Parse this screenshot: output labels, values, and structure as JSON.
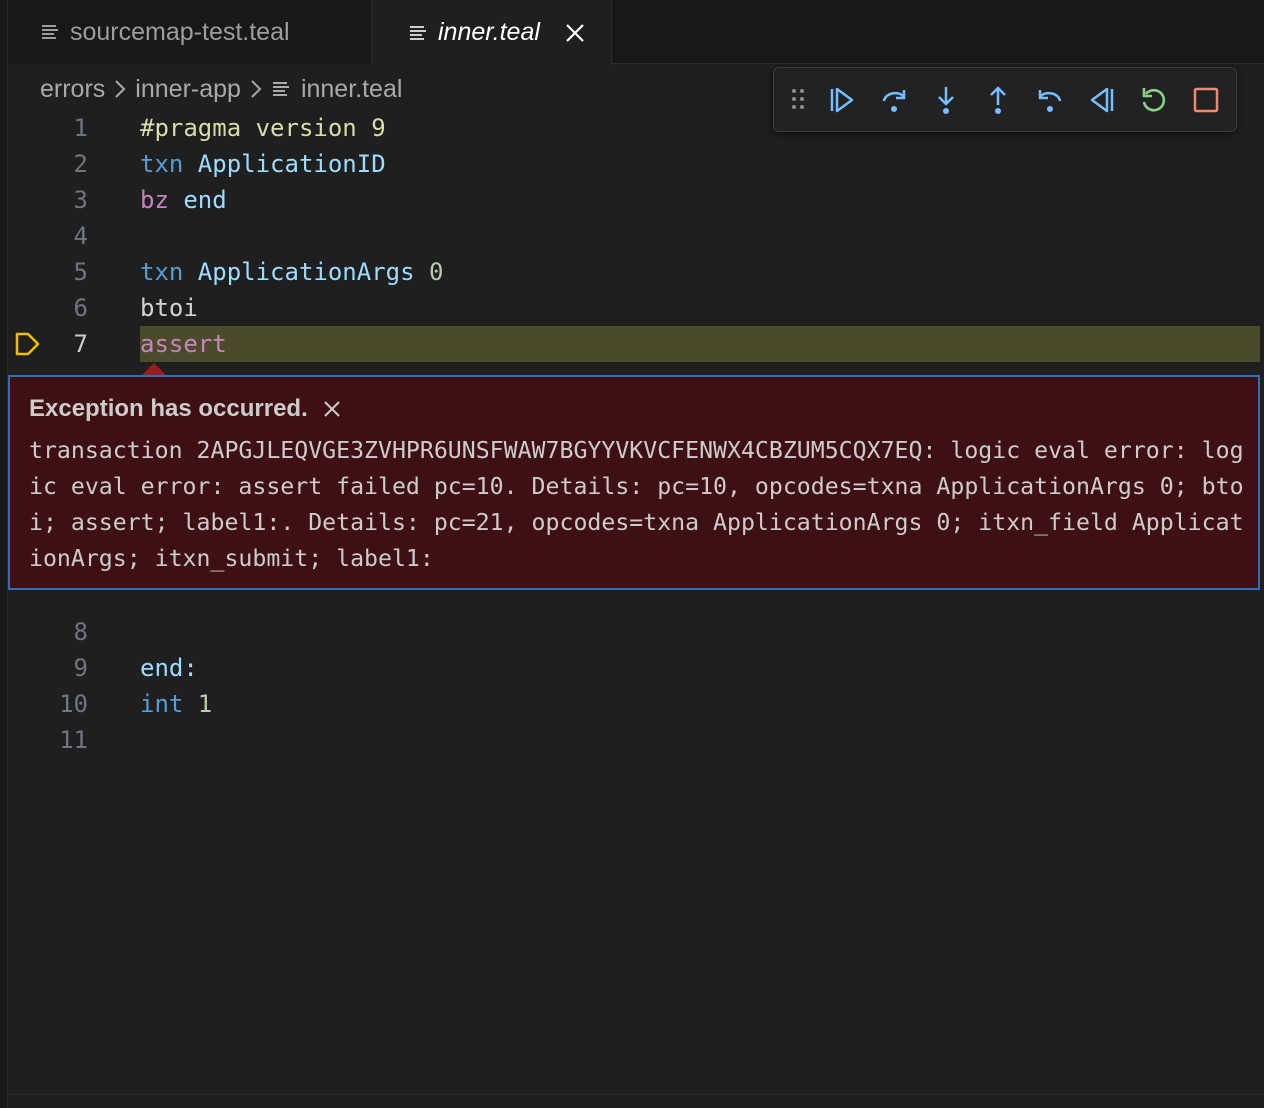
{
  "tabs": [
    {
      "label": "sourcemap-test.teal",
      "active": false
    },
    {
      "label": "inner.teal",
      "active": true
    }
  ],
  "breadcrumb": [
    "errors",
    "inner-app",
    "inner.teal"
  ],
  "debug_toolbar": {
    "buttons": [
      "drag-handle-icon",
      "continue-icon",
      "step-over-icon",
      "step-into-icon",
      "step-out-icon",
      "step-back-icon",
      "reverse-continue-icon",
      "restart-icon",
      "stop-icon"
    ],
    "colors": {
      "action": "#75beff",
      "restart": "#89d185",
      "stop": "#f48771"
    }
  },
  "editor": {
    "current_line": 7,
    "lines": [
      {
        "n": "1",
        "tokens": [
          {
            "t": "#pragma version 9",
            "c": "pragma"
          }
        ]
      },
      {
        "n": "2",
        "tokens": [
          {
            "t": "txn ",
            "c": "kw-blue"
          },
          {
            "t": "ApplicationID",
            "c": "id-light"
          }
        ]
      },
      {
        "n": "3",
        "tokens": [
          {
            "t": "bz ",
            "c": "kw-pink"
          },
          {
            "t": "end",
            "c": "id-light"
          }
        ]
      },
      {
        "n": "4",
        "tokens": []
      },
      {
        "n": "5",
        "tokens": [
          {
            "t": "txn ",
            "c": "kw-blue"
          },
          {
            "t": "ApplicationArgs ",
            "c": "id-light"
          },
          {
            "t": "0",
            "c": "num"
          }
        ]
      },
      {
        "n": "6",
        "tokens": [
          {
            "t": "btoi",
            "c": "plain"
          }
        ]
      },
      {
        "n": "7",
        "tokens": [
          {
            "t": "assert",
            "c": "kw-pink"
          }
        ]
      },
      {
        "n": "8",
        "tokens": []
      },
      {
        "n": "9",
        "tokens": [
          {
            "t": "end:",
            "c": "id-light"
          }
        ]
      },
      {
        "n": "10",
        "tokens": [
          {
            "t": "int ",
            "c": "kw-blue"
          },
          {
            "t": "1",
            "c": "num"
          }
        ]
      },
      {
        "n": "11",
        "tokens": []
      }
    ]
  },
  "exception": {
    "title": "Exception has occurred.",
    "message": "transaction 2APGJLEQVGE3ZVHPR6UNSFWAW7BGYYVKVCFENWX4CBZUM5CQX7EQ: logic eval error: logic eval error: assert failed pc=10. Details: pc=10, opcodes=txna ApplicationArgs 0; btoi; assert; label1:. Details: pc=21, opcodes=txna ApplicationArgs 0; itxn_field ApplicationArgs; itxn_submit; label1:"
  }
}
